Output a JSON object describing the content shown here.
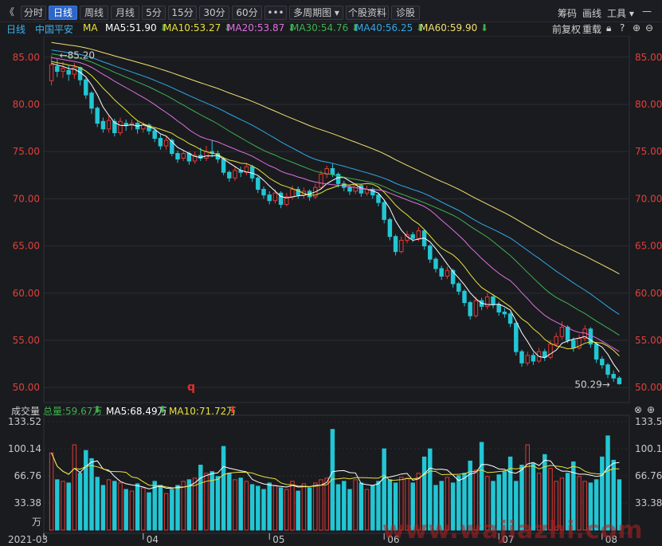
{
  "toolbar": {
    "back": "《",
    "tabs": [
      "分时",
      "日线",
      "周线",
      "月线",
      "5分",
      "15分",
      "30分",
      "60分",
      "•••",
      "多周期图 ▾",
      "个股资料",
      "诊股"
    ],
    "active_tab": 1,
    "right_tools": [
      "筹码",
      "画线",
      "工具 ▾"
    ]
  },
  "ma_bar": {
    "period": "日线",
    "stock": "中国平安",
    "ma_label": "MA",
    "items": [
      {
        "text": "MA5:51.90",
        "color": "#ffffff"
      },
      {
        "text": "MA10:53.27",
        "color": "#e8e23a"
      },
      {
        "text": "MA20:53.87",
        "color": "#e070e0"
      },
      {
        "text": "MA30:54.76",
        "color": "#3fb050"
      },
      {
        "text": "MA40:56.25",
        "color": "#2fa8e8"
      },
      {
        "text": "MA60:59.90",
        "color": "#f0e070"
      }
    ],
    "right": [
      "前复权",
      "重载"
    ]
  },
  "vol_bar": {
    "label": "成交量",
    "total": "总量:59.67万",
    "ma5": "MA5:68.49万",
    "ma10": "MA10:71.72万"
  },
  "annotations": {
    "high": "85.20",
    "low": "50.29",
    "q_marker": "q"
  },
  "watermark": "www.wajiazhi.com",
  "chart_data": {
    "type": "candlestick",
    "price_axis": {
      "ticks": [
        50.0,
        55.0,
        60.0,
        65.0,
        70.0,
        75.0,
        80.0,
        85.0
      ],
      "range": [
        49.0,
        86.5
      ]
    },
    "volume_axis": {
      "ticks": [
        "133.52",
        "100.14",
        "66.76",
        "33.38"
      ],
      "unit": "万",
      "range": [
        0,
        133.52
      ]
    },
    "x_labels": [
      "2021-03",
      "04",
      "05",
      "06",
      "07",
      "08"
    ],
    "candles": [
      [
        82.5,
        84.2,
        85.2,
        82.0
      ],
      [
        84.0,
        83.5,
        84.8,
        82.9
      ],
      [
        83.5,
        83.8,
        84.5,
        82.8
      ],
      [
        83.6,
        83.2,
        84.1,
        82.5
      ],
      [
        83.2,
        83.9,
        84.4,
        82.7
      ],
      [
        83.9,
        82.6,
        84.0,
        82.0
      ],
      [
        82.6,
        81.0,
        82.8,
        80.6
      ],
      [
        81.2,
        79.6,
        81.4,
        79.0
      ],
      [
        79.6,
        78.0,
        79.8,
        77.6
      ],
      [
        78.2,
        77.4,
        78.6,
        77.0
      ],
      [
        77.4,
        78.3,
        78.8,
        77.0
      ],
      [
        78.2,
        77.0,
        78.5,
        76.6
      ],
      [
        77.0,
        78.2,
        78.6,
        76.7
      ],
      [
        78.0,
        77.8,
        78.4,
        77.2
      ],
      [
        77.8,
        78.0,
        78.4,
        77.3
      ],
      [
        78.0,
        77.4,
        78.2,
        76.9
      ],
      [
        77.4,
        77.8,
        78.1,
        77.0
      ],
      [
        77.8,
        77.2,
        78.0,
        76.8
      ],
      [
        77.2,
        76.4,
        77.5,
        76.0
      ],
      [
        76.4,
        75.6,
        76.8,
        75.2
      ],
      [
        75.6,
        76.2,
        76.7,
        75.2
      ],
      [
        76.2,
        74.8,
        76.4,
        74.5
      ],
      [
        74.8,
        74.2,
        75.1,
        73.8
      ],
      [
        74.3,
        74.8,
        75.2,
        74.0
      ],
      [
        74.8,
        74.0,
        75.0,
        73.6
      ],
      [
        74.0,
        74.6,
        75.0,
        73.7
      ],
      [
        74.6,
        74.3,
        75.4,
        74.0
      ],
      [
        74.3,
        75.0,
        75.6,
        74.0
      ],
      [
        75.0,
        74.8,
        76.2,
        74.4
      ],
      [
        74.8,
        74.2,
        75.1,
        73.8
      ],
      [
        74.2,
        72.8,
        74.4,
        72.5
      ],
      [
        72.8,
        72.2,
        73.0,
        71.8
      ],
      [
        72.2,
        73.0,
        73.4,
        71.9
      ],
      [
        73.0,
        72.8,
        73.4,
        72.3
      ],
      [
        72.8,
        73.4,
        73.8,
        72.5
      ],
      [
        73.4,
        72.2,
        73.6,
        71.8
      ],
      [
        72.2,
        71.0,
        72.4,
        70.6
      ],
      [
        71.0,
        70.4,
        71.3,
        70.0
      ],
      [
        70.4,
        69.8,
        70.8,
        69.4
      ],
      [
        69.8,
        70.6,
        71.0,
        69.5
      ],
      [
        70.6,
        69.4,
        70.8,
        69.0
      ],
      [
        69.4,
        70.2,
        70.6,
        69.2
      ],
      [
        70.2,
        71.0,
        71.4,
        69.9
      ],
      [
        71.0,
        70.4,
        71.3,
        70.0
      ],
      [
        70.4,
        70.8,
        71.2,
        70.0
      ],
      [
        70.8,
        70.2,
        71.0,
        69.8
      ],
      [
        70.2,
        71.2,
        71.6,
        70.0
      ],
      [
        71.2,
        72.6,
        73.0,
        71.0
      ],
      [
        72.6,
        73.2,
        73.5,
        72.2
      ],
      [
        73.2,
        72.6,
        73.8,
        72.3
      ],
      [
        72.6,
        71.6,
        72.8,
        71.2
      ],
      [
        71.6,
        71.2,
        71.9,
        70.8
      ],
      [
        71.2,
        70.8,
        71.5,
        70.4
      ],
      [
        70.8,
        71.4,
        71.7,
        70.5
      ],
      [
        71.4,
        70.6,
        71.6,
        70.2
      ],
      [
        70.6,
        71.0,
        71.4,
        70.3
      ],
      [
        71.0,
        70.4,
        71.2,
        70.0
      ],
      [
        70.4,
        69.6,
        70.6,
        69.2
      ],
      [
        69.6,
        67.8,
        69.8,
        67.4
      ],
      [
        67.8,
        66.0,
        68.0,
        65.6
      ],
      [
        66.0,
        64.4,
        66.2,
        64.0
      ],
      [
        64.4,
        65.6,
        66.0,
        64.2
      ],
      [
        65.6,
        66.2,
        66.6,
        65.3
      ],
      [
        66.2,
        65.8,
        66.5,
        65.4
      ],
      [
        65.8,
        66.6,
        67.0,
        65.5
      ],
      [
        66.6,
        65.0,
        66.8,
        64.6
      ],
      [
        65.0,
        63.6,
        65.2,
        63.2
      ],
      [
        63.6,
        62.6,
        63.8,
        62.2
      ],
      [
        62.6,
        61.8,
        62.9,
        61.4
      ],
      [
        61.8,
        62.4,
        62.8,
        61.5
      ],
      [
        62.4,
        61.0,
        62.6,
        60.6
      ],
      [
        61.0,
        60.2,
        61.2,
        59.8
      ],
      [
        60.2,
        59.0,
        60.4,
        58.6
      ],
      [
        59.0,
        57.6,
        59.2,
        57.2
      ],
      [
        57.6,
        59.2,
        59.6,
        57.4
      ],
      [
        59.2,
        58.6,
        59.5,
        58.2
      ],
      [
        58.6,
        59.6,
        60.0,
        58.3
      ],
      [
        59.6,
        58.8,
        59.9,
        58.4
      ],
      [
        58.8,
        58.0,
        59.1,
        57.6
      ],
      [
        58.0,
        57.8,
        58.4,
        57.4
      ],
      [
        57.8,
        56.8,
        58.0,
        56.4
      ],
      [
        56.8,
        53.8,
        57.0,
        53.4
      ],
      [
        53.8,
        52.6,
        54.0,
        52.2
      ],
      [
        52.6,
        53.4,
        53.8,
        52.3
      ],
      [
        53.4,
        52.8,
        53.7,
        52.4
      ],
      [
        52.8,
        53.8,
        54.2,
        52.6
      ],
      [
        53.8,
        53.2,
        54.1,
        52.8
      ],
      [
        53.2,
        54.6,
        55.0,
        53.0
      ],
      [
        54.6,
        55.4,
        55.8,
        54.3
      ],
      [
        55.4,
        56.4,
        57.0,
        55.1
      ],
      [
        56.4,
        55.0,
        56.6,
        54.7
      ],
      [
        55.0,
        54.2,
        55.3,
        53.8
      ],
      [
        54.2,
        55.2,
        55.6,
        54.0
      ],
      [
        55.2,
        56.2,
        56.6,
        54.9
      ],
      [
        56.2,
        54.6,
        56.4,
        54.2
      ],
      [
        54.6,
        53.0,
        54.8,
        52.6
      ],
      [
        53.0,
        52.4,
        53.3,
        52.0
      ],
      [
        52.4,
        51.4,
        52.6,
        51.0
      ],
      [
        51.4,
        51.0,
        51.8,
        50.6
      ],
      [
        51.0,
        50.4,
        51.2,
        50.29
      ]
    ],
    "volumes": [
      95,
      62,
      60,
      58,
      105,
      70,
      98,
      88,
      65,
      55,
      62,
      60,
      58,
      50,
      48,
      57,
      52,
      46,
      60,
      55,
      45,
      50,
      55,
      60,
      62,
      64,
      80,
      70,
      72,
      66,
      103,
      70,
      62,
      64,
      60,
      56,
      54,
      50,
      58,
      55,
      52,
      50,
      60,
      48,
      57,
      52,
      58,
      62,
      64,
      124,
      56,
      60,
      50,
      62,
      58,
      50,
      55,
      60,
      100,
      62,
      58,
      65,
      64,
      58,
      70,
      90,
      100,
      55,
      60,
      65,
      58,
      67,
      70,
      85,
      74,
      108,
      66,
      60,
      68,
      72,
      90,
      60,
      80,
      105,
      82,
      70,
      93,
      76,
      60,
      64,
      70,
      84,
      66,
      60,
      58,
      62,
      90,
      116,
      86,
      62
    ],
    "ma_lines": [
      {
        "name": "MA5",
        "color": "#ffffff"
      },
      {
        "name": "MA10",
        "color": "#e8e23a"
      },
      {
        "name": "MA20",
        "color": "#e070e0"
      },
      {
        "name": "MA30",
        "color": "#3fb050"
      },
      {
        "name": "MA40",
        "color": "#2fa8e8"
      },
      {
        "name": "MA60",
        "color": "#f0e070"
      }
    ],
    "ma_end_values": [
      51.9,
      53.27,
      53.87,
      54.76,
      56.25,
      59.9
    ],
    "colors": {
      "up": "#e53935",
      "down": "#23c6d4",
      "axis_text_price": "#e0403a",
      "axis_text_vol": "#c8c8c8"
    }
  }
}
